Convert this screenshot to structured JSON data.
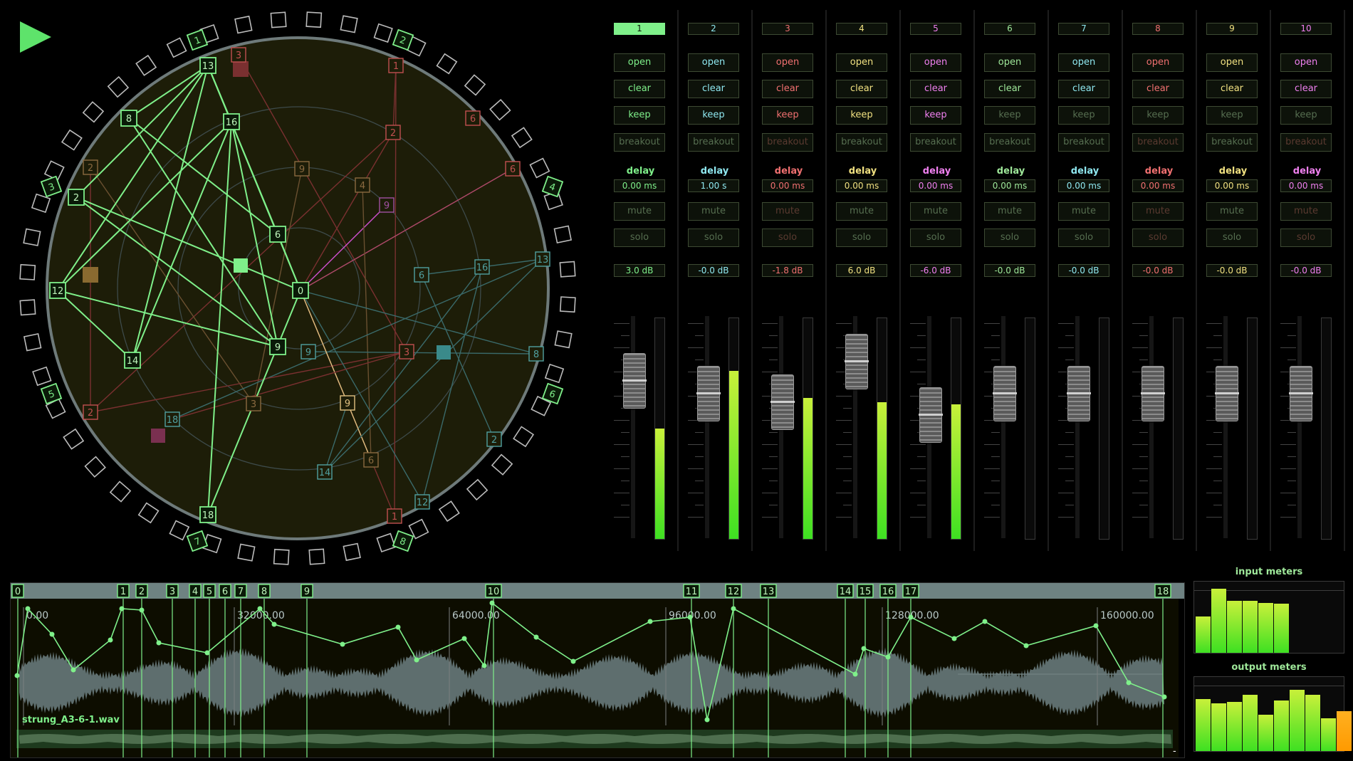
{
  "transport": {
    "play_icon": "play-icon"
  },
  "graph": {
    "ring_labels": [
      "1",
      "2",
      "3",
      "4",
      "5",
      "6",
      "7",
      "8"
    ],
    "active_nodes": [
      "13",
      "16",
      "8",
      "2",
      "6",
      "12",
      "0",
      "9",
      "14",
      "18"
    ],
    "inactive_nodes": [
      "3",
      "1",
      "2",
      "6",
      "9",
      "4",
      "9",
      "6",
      "16",
      "13",
      "6",
      "9",
      "3",
      "8",
      "3",
      "2",
      "18",
      "2",
      "14",
      "6",
      "12",
      "1"
    ]
  },
  "channels": [
    {
      "num": "1",
      "open": "open",
      "clear": "clear",
      "keep": "keep",
      "breakout": "breakout",
      "delay_label": "delay",
      "delay": "0.00 ms",
      "mute": "mute",
      "solo": "solo",
      "gain": "3.0 dB",
      "color": "#7ff08a",
      "fader": 0.14,
      "level": 0.5,
      "selected": true
    },
    {
      "num": "2",
      "open": "open",
      "clear": "clear",
      "keep": "keep",
      "breakout": "breakout",
      "delay_label": "delay",
      "delay": "1.00 s",
      "mute": "mute",
      "solo": "solo",
      "gain": "-0.0 dB",
      "color": "#8fe8f0",
      "fader": 0.2,
      "level": 0.76,
      "selected": false
    },
    {
      "num": "3",
      "open": "open",
      "clear": "clear",
      "keep": "keep",
      "breakout": "breakout",
      "delay_label": "delay",
      "delay": "0.00 ms",
      "mute": "mute",
      "solo": "solo",
      "gain": "-1.8 dB",
      "color": "#f07070",
      "fader": 0.24,
      "level": 0.64,
      "selected": false
    },
    {
      "num": "4",
      "open": "open",
      "clear": "clear",
      "keep": "keep",
      "breakout": "breakout",
      "delay_label": "delay",
      "delay": "0.00 ms",
      "mute": "mute",
      "solo": "solo",
      "gain": "6.0 dB",
      "color": "#f0e080",
      "fader": 0.05,
      "level": 0.62,
      "selected": false
    },
    {
      "num": "5",
      "open": "open",
      "clear": "clear",
      "keep": "keep",
      "breakout": "breakout",
      "delay_label": "delay",
      "delay": "0.00 ms",
      "mute": "mute",
      "solo": "solo",
      "gain": "-6.0 dB",
      "color": "#f080f0",
      "fader": 0.3,
      "level": 0.61,
      "selected": false
    },
    {
      "num": "6",
      "open": "open",
      "clear": "clear",
      "keep": "keep",
      "breakout": "breakout",
      "delay_label": "delay",
      "delay": "0.00 ms",
      "mute": "mute",
      "solo": "solo",
      "gain": "-0.0 dB",
      "color": "#9fe89a",
      "fader": 0.2,
      "level": 0,
      "selected": false
    },
    {
      "num": "7",
      "open": "open",
      "clear": "clear",
      "keep": "keep",
      "breakout": "breakout",
      "delay_label": "delay",
      "delay": "0.00 ms",
      "mute": "mute",
      "solo": "solo",
      "gain": "-0.0 dB",
      "color": "#8fe8f0",
      "fader": 0.2,
      "level": 0,
      "selected": false
    },
    {
      "num": "8",
      "open": "open",
      "clear": "clear",
      "keep": "keep",
      "breakout": "breakout",
      "delay_label": "delay",
      "delay": "0.00 ms",
      "mute": "mute",
      "solo": "solo",
      "gain": "-0.0 dB",
      "color": "#f07070",
      "fader": 0.2,
      "level": 0,
      "selected": false
    },
    {
      "num": "9",
      "open": "open",
      "clear": "clear",
      "keep": "keep",
      "breakout": "breakout",
      "delay_label": "delay",
      "delay": "0.00 ms",
      "mute": "mute",
      "solo": "solo",
      "gain": "-0.0 dB",
      "color": "#f0e080",
      "fader": 0.2,
      "level": 0,
      "selected": false
    },
    {
      "num": "10",
      "open": "open",
      "clear": "clear",
      "keep": "keep",
      "breakout": "breakout",
      "delay_label": "delay",
      "delay": "0.00 ms",
      "mute": "mute",
      "solo": "solo",
      "gain": "-0.0 dB",
      "color": "#f080f0",
      "fader": 0.2,
      "level": 0,
      "selected": false
    }
  ],
  "timeline": {
    "file_name": "strung_A3-6-1.wav",
    "ruler_labels": [
      "0.00",
      "32000.00",
      "64000.00",
      "96000.00",
      "128000.00",
      "160000.00"
    ],
    "markers": [
      "0",
      "1",
      "2",
      "3",
      "4",
      "5",
      "6",
      "7",
      "8",
      "9",
      "10",
      "11",
      "12",
      "13",
      "14",
      "15",
      "16",
      "17",
      "18"
    ],
    "scroll_indicator": "-"
  },
  "meters": {
    "input_title": "input meters",
    "output_title": "output meters",
    "input_levels": [
      0.52,
      0.92,
      0.75,
      0.74,
      0.71,
      0.7
    ],
    "output_levels": [
      0.72,
      0.66,
      0.68,
      0.77,
      0.5,
      0.7,
      0.84,
      0.77,
      0.45,
      0.55
    ]
  }
}
